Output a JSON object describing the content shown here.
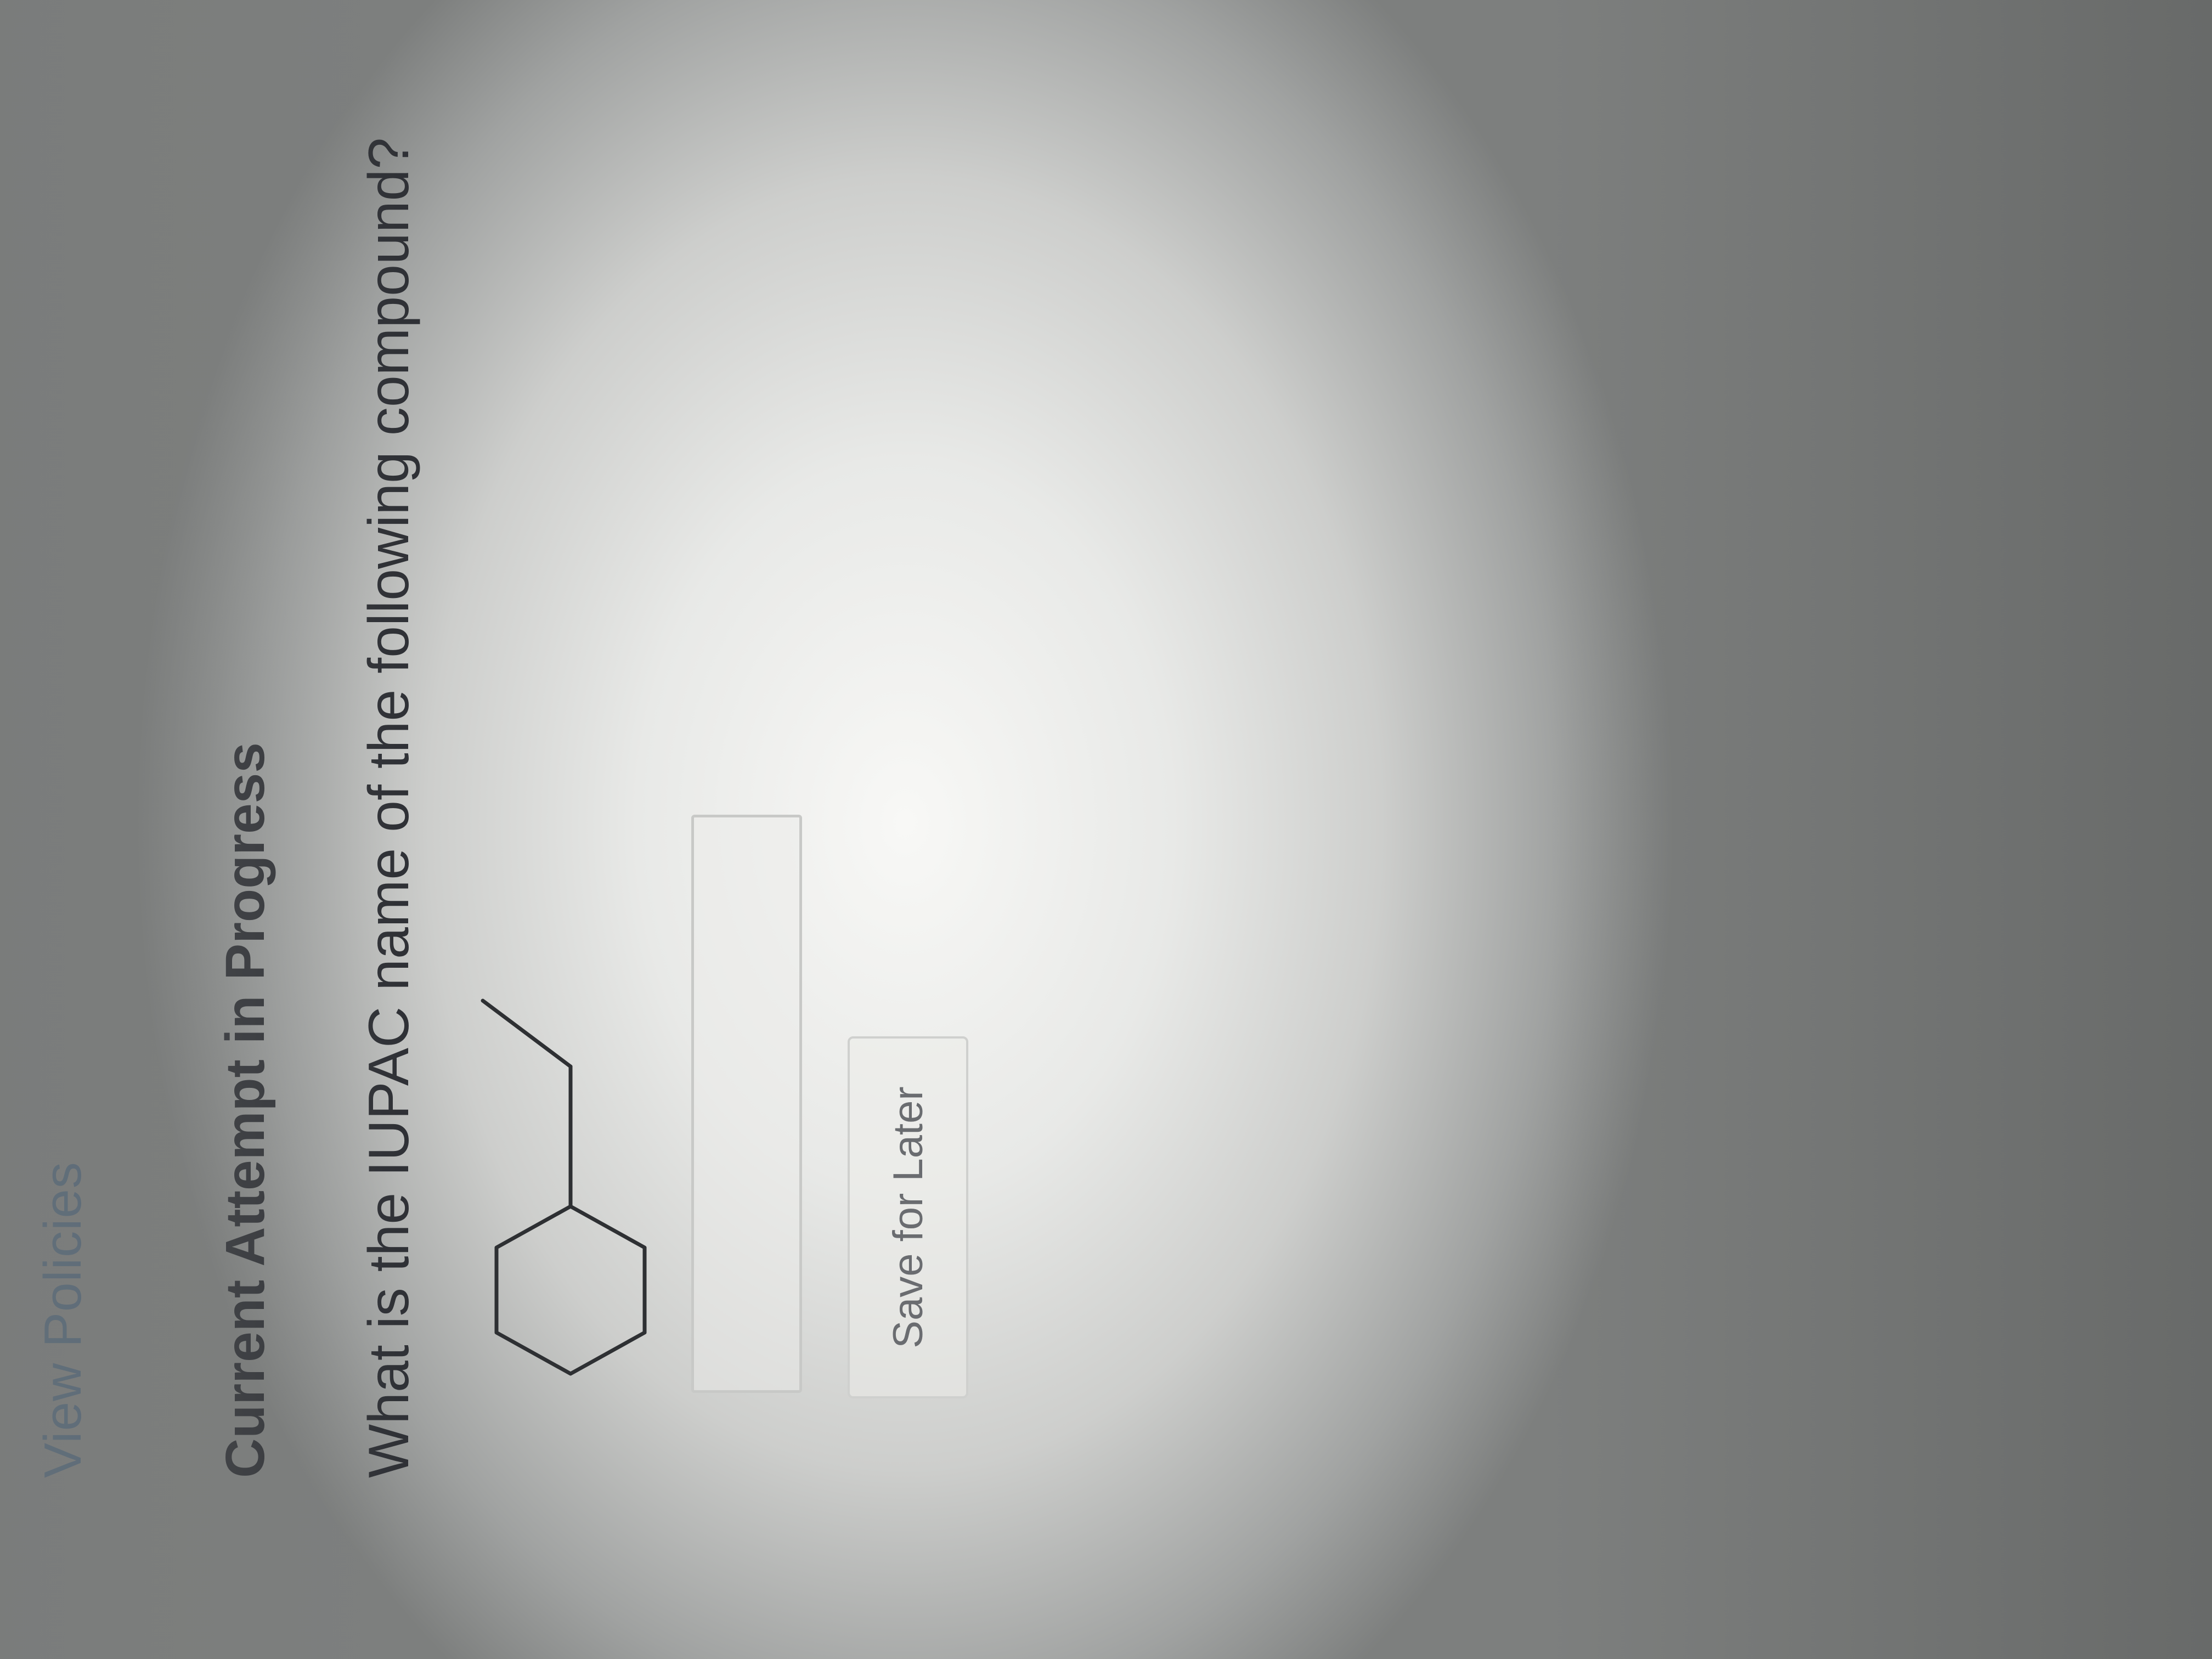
{
  "header": {
    "view_policies_label": "View Policies"
  },
  "attempt": {
    "title": "Current Attempt in Progress"
  },
  "question": {
    "prompt": "What is the IUPAC name of the following compound?",
    "structure_icon": "ethylcyclohexane-skeletal-structure-icon"
  },
  "answer": {
    "value": ""
  },
  "actions": {
    "save_label": "Save for Later"
  }
}
